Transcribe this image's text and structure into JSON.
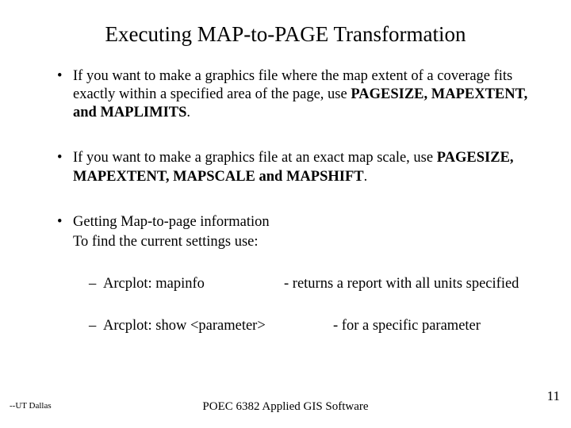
{
  "title": "Executing MAP-to-PAGE Transformation",
  "bullets": {
    "b1_pre": "If you want to make a graphics file where the map extent of a coverage fits exactly within a specified area of the page, use ",
    "b1_bold": "PAGESIZE, MAPEXTENT, and MAPLIMITS",
    "b1_post": ".",
    "b2_pre": "If you want to make a graphics file at an exact map scale, use ",
    "b2_bold": "PAGESIZE, MAPEXTENT, MAPSCALE and MAPSHIFT",
    "b2_post": ".",
    "b3_line1": "Getting Map-to-page information",
    "b3_line2": "To find the current settings use:",
    "sub1_left": "Arcplot: mapinfo",
    "sub1_right": "- returns a report with all units specified",
    "sub2_left": "Arcplot: show <parameter>",
    "sub2_right": "- for a specific parameter"
  },
  "footer": {
    "left": "--UT Dallas",
    "center": "POEC 6382 Applied GIS Software",
    "right": "11"
  }
}
